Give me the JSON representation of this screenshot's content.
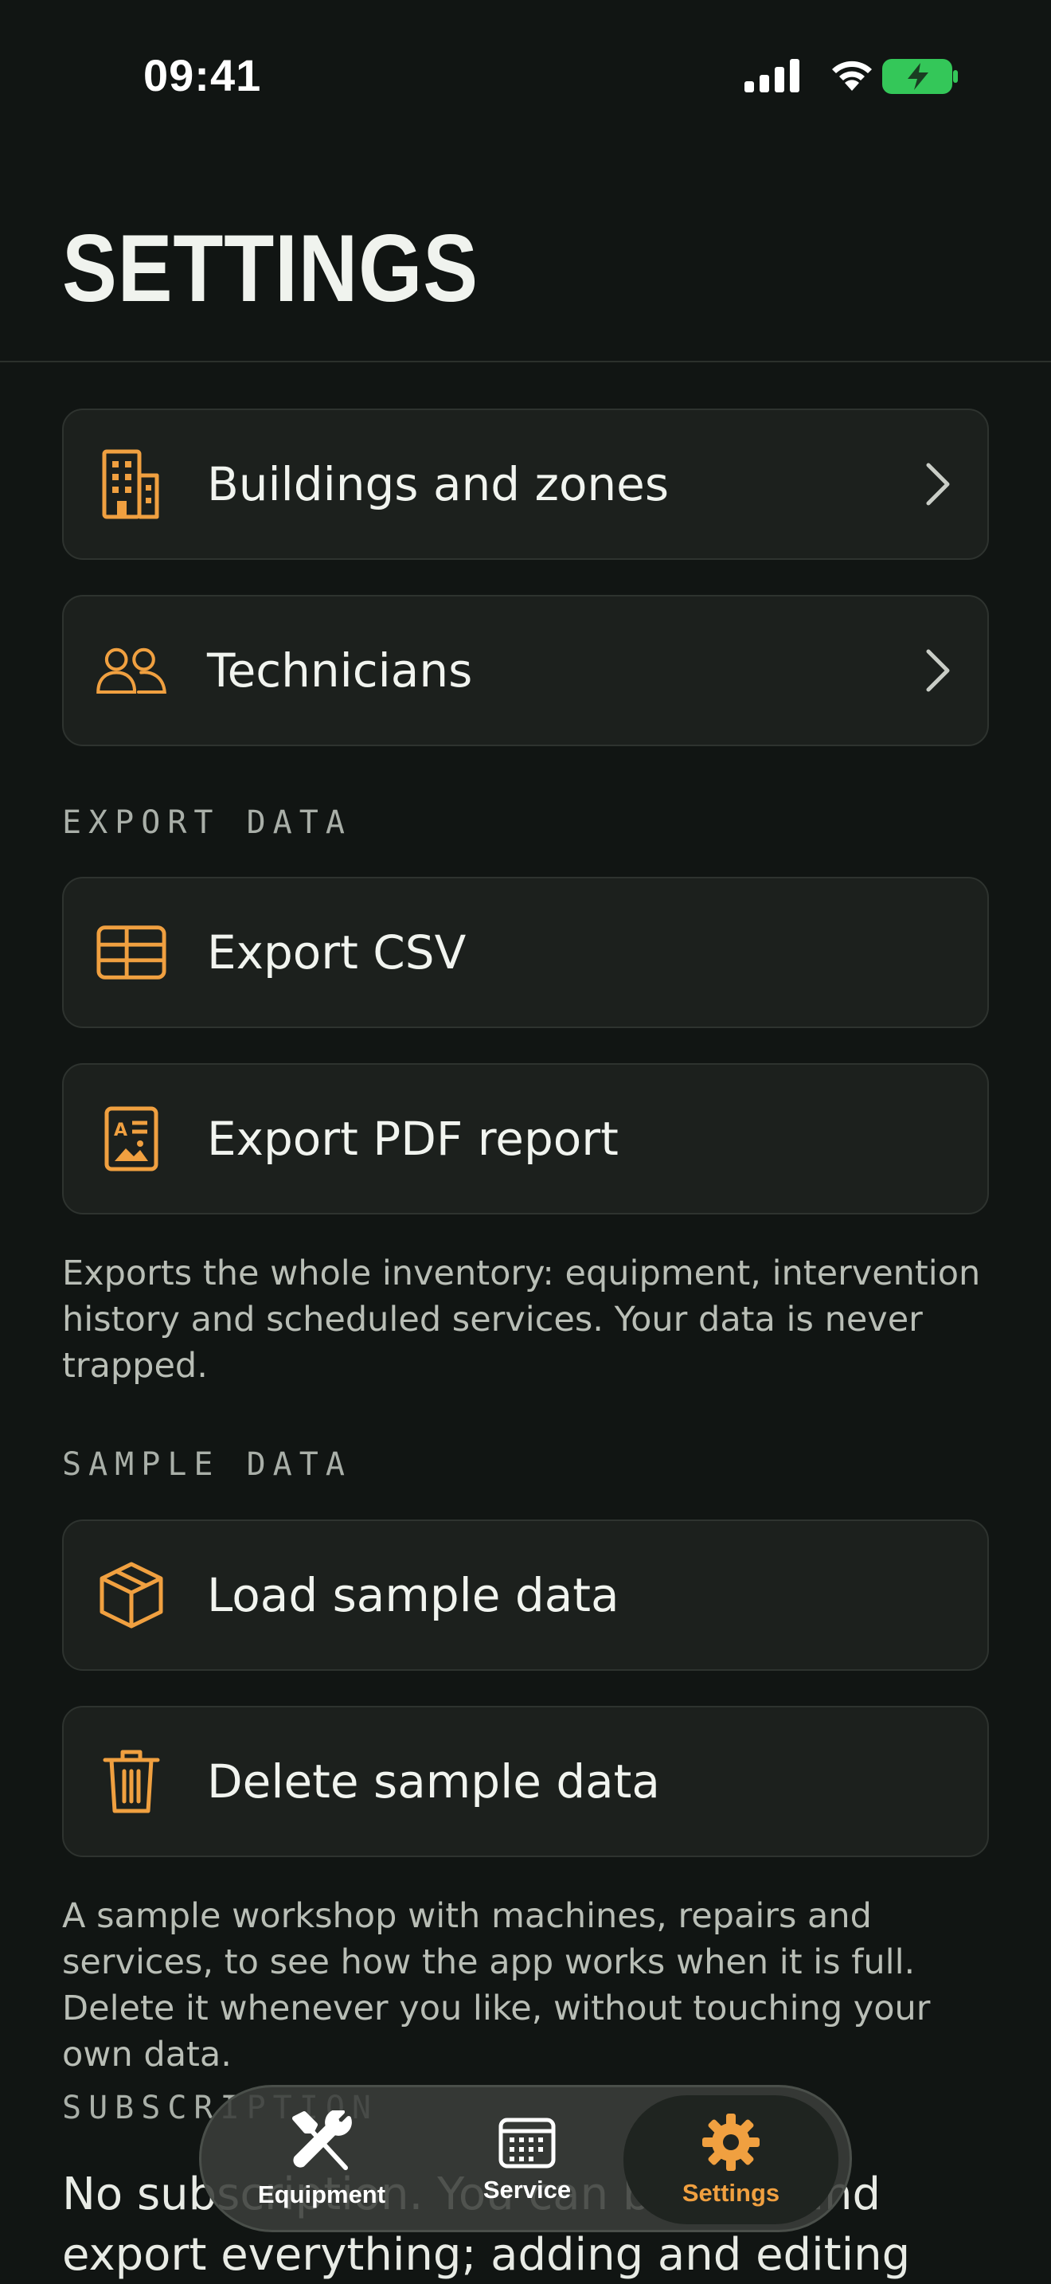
{
  "status_bar": {
    "time": "09:41"
  },
  "page": {
    "title": "SETTINGS"
  },
  "rows_top": [
    {
      "label": "Buildings and zones",
      "icon": "building-icon"
    },
    {
      "label": "Technicians",
      "icon": "people-icon"
    }
  ],
  "export": {
    "header": "EXPORT DATA",
    "rows": [
      {
        "label": "Export CSV",
        "icon": "table-icon"
      },
      {
        "label": "Export PDF report",
        "icon": "document-icon"
      }
    ],
    "note": "Exports the whole inventory: equipment, intervention history and scheduled services. Your data is never trapped."
  },
  "sample": {
    "header": "SAMPLE DATA",
    "rows": [
      {
        "label": "Load sample data",
        "icon": "box-icon"
      },
      {
        "label": "Delete sample data",
        "icon": "trash-icon"
      }
    ],
    "note": "A sample workshop with machines, repairs and services, to see how the app works when it is full. Delete it whenever you like, without touching your own data."
  },
  "subscription": {
    "header": "SUBSCRIPTION",
    "text_line1": "No subscription. You can browse and",
    "text_line2": "export everything; adding and editing"
  },
  "tabs": [
    {
      "label": "Equipment",
      "icon": "tools-icon",
      "active": false
    },
    {
      "label": "Service",
      "icon": "calendar-icon",
      "active": false
    },
    {
      "label": "Settings",
      "icon": "gear-icon",
      "active": true
    }
  ],
  "colors": {
    "accent": "#F0A040",
    "background": "#111513",
    "card": "#1C201D",
    "battery": "#34C759"
  }
}
